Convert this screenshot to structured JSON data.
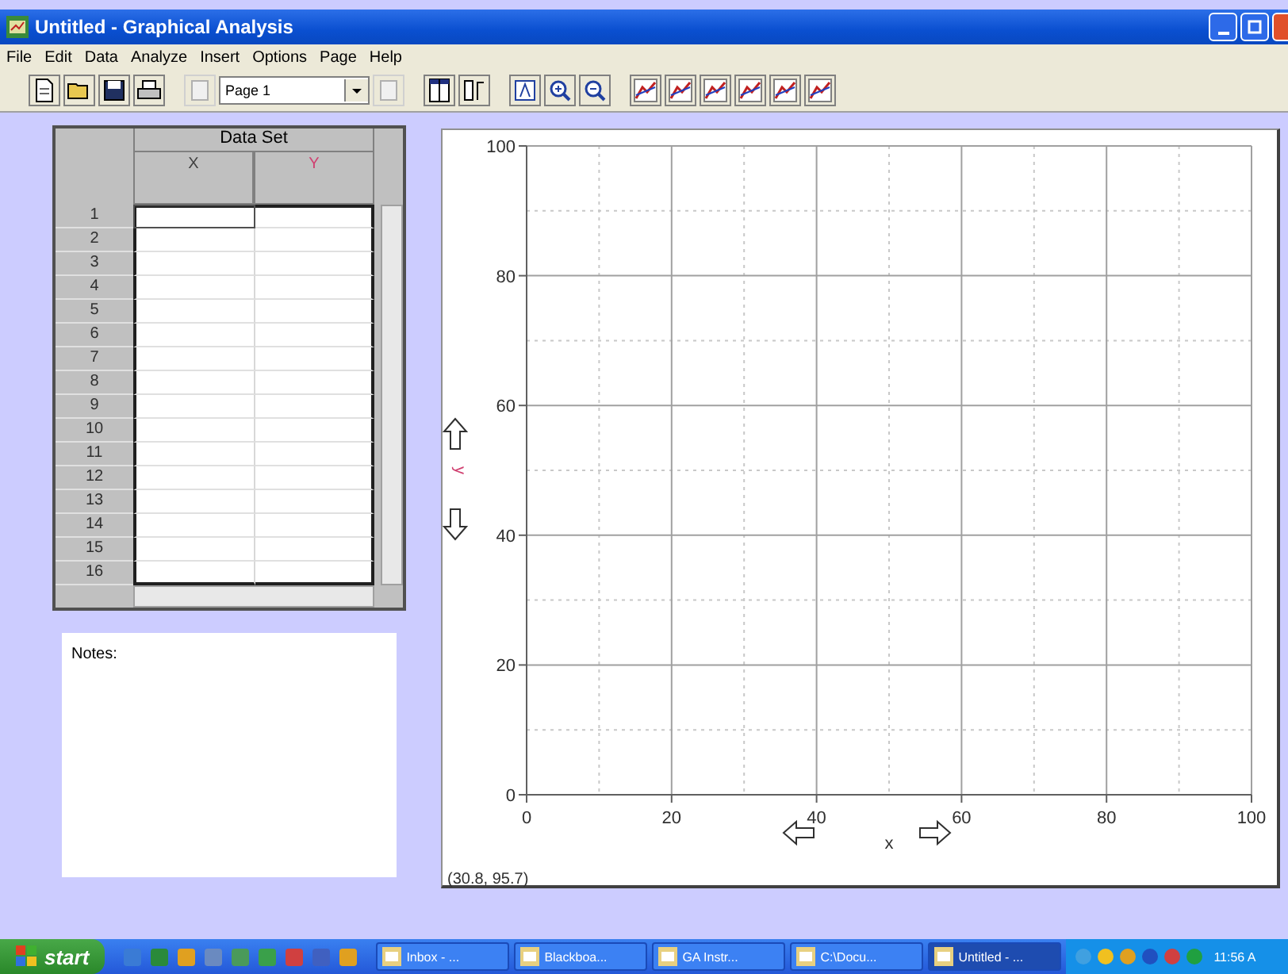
{
  "window": {
    "title": "Untitled - Graphical Analysis"
  },
  "menu": [
    "File",
    "Edit",
    "Data",
    "Analyze",
    "Insert",
    "Options",
    "Page",
    "Help"
  ],
  "toolbar": [
    {
      "kind": "new"
    },
    {
      "kind": "open"
    },
    {
      "kind": "save"
    },
    {
      "kind": "print"
    },
    {
      "kind": "gap"
    },
    {
      "kind": "page-prev"
    },
    {
      "kind": "page-select",
      "value": "Page 1"
    },
    {
      "kind": "page-next"
    },
    {
      "kind": "gap"
    },
    {
      "kind": "table"
    },
    {
      "kind": "columns"
    },
    {
      "kind": "gap"
    },
    {
      "kind": "autoscale"
    },
    {
      "kind": "zoom-in"
    },
    {
      "kind": "zoom-out"
    },
    {
      "kind": "gap"
    },
    {
      "kind": "fit"
    },
    {
      "kind": "fit"
    },
    {
      "kind": "fit"
    },
    {
      "kind": "fit"
    },
    {
      "kind": "fit"
    },
    {
      "kind": "fit"
    }
  ],
  "table": {
    "title": "Data Set",
    "columns": [
      {
        "label": "X",
        "color": "#404040"
      },
      {
        "label": "Y",
        "color": "#d04070"
      }
    ],
    "rows": [
      {
        "label": "1",
        "selected": true
      },
      {
        "label": "2",
        "selected": false
      },
      {
        "label": "3",
        "selected": false
      },
      {
        "label": "4",
        "selected": false
      },
      {
        "label": "5",
        "selected": false
      },
      {
        "label": "6",
        "selected": false
      },
      {
        "label": "7",
        "selected": false
      },
      {
        "label": "8",
        "selected": false
      },
      {
        "label": "9",
        "selected": false
      },
      {
        "label": "10",
        "selected": false
      },
      {
        "label": "11",
        "selected": false
      },
      {
        "label": "12",
        "selected": false
      },
      {
        "label": "13",
        "selected": false
      },
      {
        "label": "14",
        "selected": false
      },
      {
        "label": "15",
        "selected": false
      },
      {
        "label": "16",
        "selected": false
      }
    ]
  },
  "notes": {
    "label": "Notes:"
  },
  "graph": {
    "chart_data": {
      "type": "scatter",
      "grid": true,
      "xlabel": "x",
      "ylabel": "y",
      "xlim": [
        0,
        100
      ],
      "ylim": [
        0,
        100
      ],
      "xticks": [
        0,
        20,
        40,
        60,
        80,
        100
      ],
      "yticks": [
        0,
        20,
        40,
        60,
        80,
        100
      ]
    },
    "coordinates": "(30.8, 95.7)"
  },
  "taskbar": {
    "start": "start",
    "tasks": [
      {
        "label": "Inbox - ...",
        "selected": false
      },
      {
        "label": "Blackboa...",
        "selected": false
      },
      {
        "label": "GA Instr...",
        "selected": false
      },
      {
        "label": "C:\\Docu...",
        "selected": false
      },
      {
        "label": "Untitled - ...",
        "selected": true
      }
    ],
    "clock": "11:56 A"
  }
}
